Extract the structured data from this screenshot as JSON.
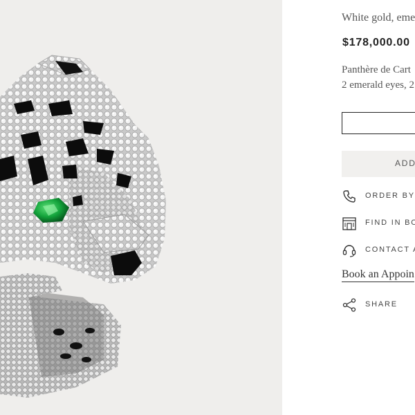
{
  "product": {
    "image_alt": "Panthère de Cartier ring",
    "subtitle": "White gold, eme",
    "price": "$178,000.00",
    "description_line1": "Panthère de Cart",
    "description_line2": "2 emerald eyes, 2"
  },
  "actions": {
    "add_label": "ADD",
    "order_by_label": "ORDER BY",
    "find_in_label": "FIND IN BOO",
    "contact_label": "CONTACT A",
    "appointment_link": "Book an Appoin",
    "share_label": "SHARE"
  },
  "icons": {
    "order": "phone-icon",
    "find": "boutique-icon",
    "contact": "headset-icon",
    "share": "share-icon"
  }
}
